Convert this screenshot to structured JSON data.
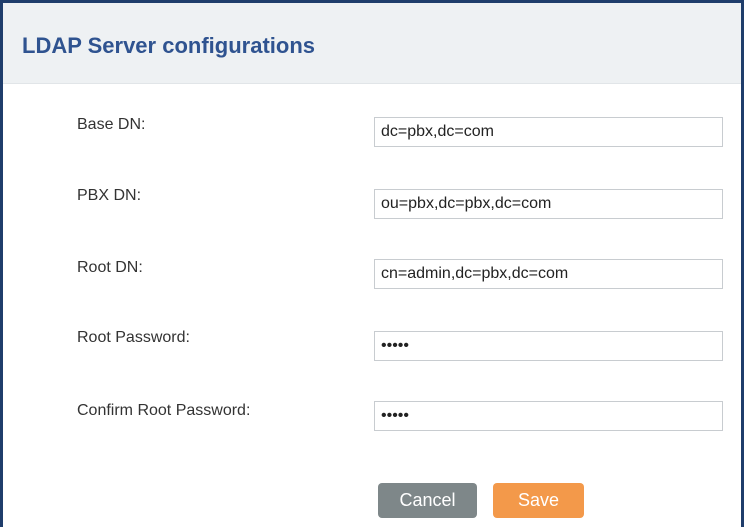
{
  "dialog": {
    "title": "LDAP Server configurations"
  },
  "form": {
    "fields": [
      {
        "label": "Base DN:",
        "value": "dc=pbx,dc=com",
        "type": "text"
      },
      {
        "label": "PBX DN:",
        "value": "ou=pbx,dc=pbx,dc=com",
        "type": "text"
      },
      {
        "label": "Root DN:",
        "value": "cn=admin,dc=pbx,dc=com",
        "type": "text"
      },
      {
        "label": "Root Password:",
        "value": "•••••",
        "type": "password"
      },
      {
        "label": "Confirm Root Password:",
        "value": "•••••",
        "type": "password"
      }
    ]
  },
  "buttons": {
    "cancel_label": "Cancel",
    "save_label": "Save"
  },
  "colors": {
    "title": "#2f5390",
    "frame_border": "#1f3d6b",
    "header_background": "#eef1f3",
    "cancel_button": "#7e8789",
    "save_button": "#f3994a"
  }
}
